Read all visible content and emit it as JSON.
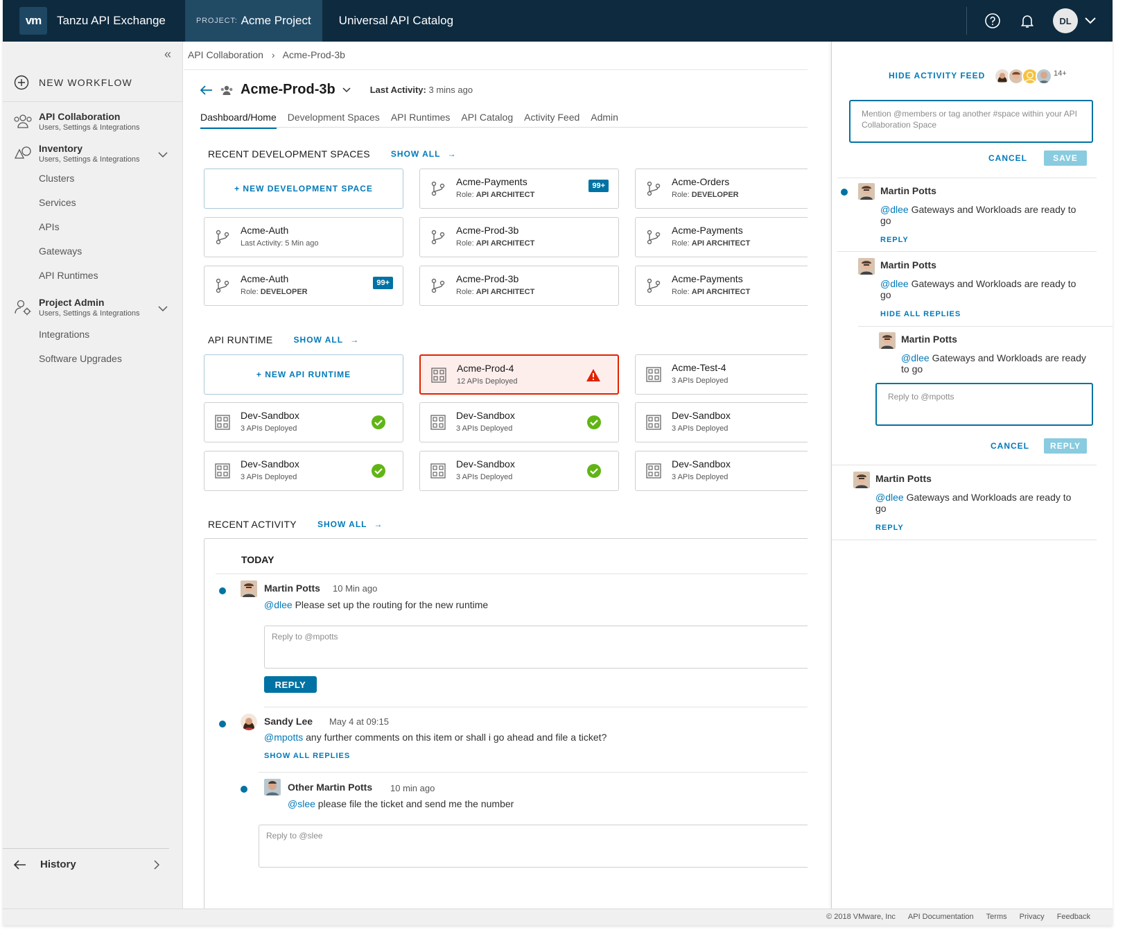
{
  "header": {
    "logo": "vm",
    "app_name": "Tanzu API Exchange",
    "project_prefix": "PROJECT:",
    "project_name": "Acme Project",
    "catalog": "Universal API Catalog",
    "user_initials": "DL",
    "icons": [
      "help-icon",
      "bell-icon",
      "chevron-down-icon"
    ]
  },
  "sidebar": {
    "new_workflow": "NEW WORKFLOW",
    "sections": [
      {
        "title": "API Collaboration",
        "subtitle": "Users, Settings & Integrations",
        "icon": "users-icon"
      },
      {
        "title": "Inventory",
        "subtitle": "Users, Settings & Integrations",
        "icon": "shapes-icon"
      },
      {
        "title": "Project Admin",
        "subtitle": "Users, Settings & Integrations",
        "icon": "user-cog-icon"
      }
    ],
    "inventory_items": [
      "Clusters",
      "Services",
      "APIs",
      "Gateways",
      "API Runtimes"
    ],
    "admin_items": [
      "Integrations",
      "Software Upgrades"
    ],
    "history": "History"
  },
  "breadcrumb": [
    "API Collaboration",
    "Acme-Prod-3b"
  ],
  "page": {
    "title": "Acme-Prod-3b",
    "last_activity_label": "Last Activity:",
    "last_activity_value": "3 mins ago",
    "tabs": [
      "Dashboard/Home",
      "Development Spaces",
      "API Runtimes",
      "API Catalog",
      "Activity Feed",
      "Admin"
    ],
    "active_tab": "Dashboard/Home"
  },
  "dev_spaces": {
    "heading": "RECENT DEVELOPMENT SPACES",
    "show_all": "SHOW ALL",
    "new_label": "+ NEW DEVELOPMENT SPACE",
    "cards": [
      {
        "name": "Acme-Payments",
        "prefix": "Role:",
        "value": "API ARCHITECT",
        "badge": "99+"
      },
      {
        "name": "Acme-Orders",
        "prefix": "Role:",
        "value": "DEVELOPER",
        "badge": ""
      },
      {
        "name": "Acme-Auth",
        "prefix": "Last Activity:",
        "value": "5 Min ago",
        "badge": ""
      },
      {
        "name": "Acme-Prod-3b",
        "prefix": "Role:",
        "value": "API ARCHITECT",
        "badge": ""
      },
      {
        "name": "Acme-Payments",
        "prefix": "Role:",
        "value": "API ARCHITECT",
        "badge": ""
      },
      {
        "name": "Acme-Auth",
        "prefix": "Role:",
        "value": "DEVELOPER",
        "badge": "99+"
      },
      {
        "name": "Acme-Prod-3b",
        "prefix": "Role:",
        "value": "API ARCHITECT",
        "badge": ""
      },
      {
        "name": "Acme-Payments",
        "prefix": "Role:",
        "value": "API ARCHITECT",
        "badge": ""
      }
    ]
  },
  "runtimes": {
    "heading": "API RUNTIME",
    "show_all": "SHOW ALL",
    "new_label": "+ NEW API RUNTIME",
    "cards": [
      {
        "name": "Acme-Prod-4",
        "sub": "12 APIs Deployed",
        "status": "error"
      },
      {
        "name": "Acme-Test-4",
        "sub": "3 APIs Deployed",
        "status": "ok"
      },
      {
        "name": "Dev-Sandbox",
        "sub": "3 APIs Deployed",
        "status": "ok"
      },
      {
        "name": "Dev-Sandbox",
        "sub": "3 APIs Deployed",
        "status": "ok"
      },
      {
        "name": "Dev-Sandbox",
        "sub": "3 APIs Deployed",
        "status": "ok"
      },
      {
        "name": "Dev-Sandbox",
        "sub": "3 APIs Deployed",
        "status": "ok"
      },
      {
        "name": "Dev-Sandbox",
        "sub": "3 APIs Deployed",
        "status": "ok"
      },
      {
        "name": "Dev-Sandbox",
        "sub": "3 APIs Deployed",
        "status": "ok"
      }
    ]
  },
  "recent_activity": {
    "heading": "RECENT ACTIVITY",
    "show_all": "SHOW ALL",
    "today": "TODAY",
    "items": [
      {
        "author": "Martin Potts",
        "time": "10 Min ago",
        "mention": "@dlee",
        "text": "Please set up the routing for the new runtime",
        "reply_placeholder": "Reply to @mpotts",
        "reply_button": "REPLY"
      },
      {
        "author": "Sandy Lee",
        "time": "May 4 at 09:15",
        "mention": "@mpotts",
        "text": "any further comments on this item or shall i go ahead and file a ticket?",
        "show_replies": "SHOW ALL REPLIES"
      },
      {
        "author": "Other Martin Potts",
        "time": "10 min ago",
        "mention": "@slee",
        "text": "please file the ticket and send me the number",
        "reply_placeholder": "Reply to @slee"
      }
    ]
  },
  "activity_panel": {
    "hide_feed": "HIDE ACTIVITY FEED",
    "more_count": "14+",
    "input_placeholder": "Mention @members or tag another #space within your API Collaboration Space",
    "cancel": "CANCEL",
    "save": "SAVE",
    "messages": [
      {
        "author": "Martin Potts",
        "mention": "@dlee",
        "text": "Gateways and Workloads are ready to go",
        "action": "REPLY"
      },
      {
        "author": "Martin Potts",
        "mention": "@dlee",
        "text": "Gateways and Workloads are ready to go",
        "action": "HIDE ALL REPLIES"
      },
      {
        "author": "Martin Potts",
        "mention": "@dlee",
        "text": "Gateways and Workloads are ready to go"
      },
      {
        "author": "Martin Potts",
        "mention": "@dlee",
        "text": "Gateways and Workloads are ready to go",
        "action": "REPLY"
      }
    ],
    "reply_placeholder": "Reply to @mpotts",
    "reply_cancel": "CANCEL",
    "reply_button": "REPLY"
  },
  "footer": {
    "copyright": "© 2018 VMware, Inc",
    "links": [
      "API Documentation",
      "Terms",
      "Privacy",
      "Feedback"
    ]
  },
  "colors": {
    "header": "#0d2a3f",
    "accent": "#0072a3",
    "success": "#60b515",
    "danger": "#e12200"
  }
}
